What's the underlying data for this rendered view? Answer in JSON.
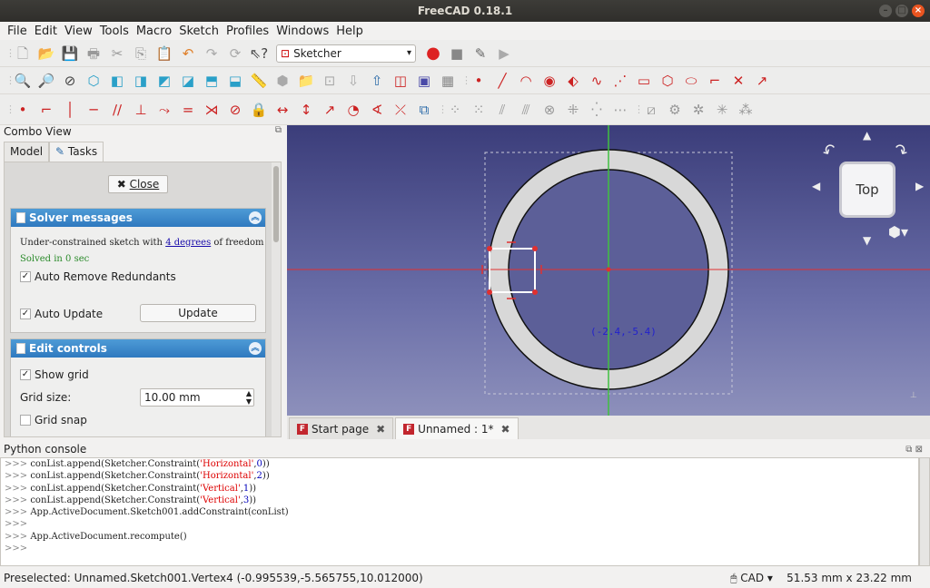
{
  "window": {
    "title": "FreeCAD 0.18.1"
  },
  "menu": [
    "File",
    "Edit",
    "View",
    "Tools",
    "Macro",
    "Sketch",
    "Profiles",
    "Windows",
    "Help"
  ],
  "workbench": "Sketcher",
  "combo": {
    "title": "Combo View",
    "tabs": [
      "Model",
      "Tasks"
    ]
  },
  "task": {
    "close_label": "Close",
    "solver": {
      "title": "Solver messages",
      "text_pre": "Under-constrained sketch with ",
      "link": "4 degrees",
      "text_post": " of freedom",
      "solved": "Solved in 0 sec",
      "auto_remove": "Auto Remove Redundants",
      "auto_update": "Auto Update",
      "update_btn": "Update"
    },
    "edit": {
      "title": "Edit controls",
      "show_grid": "Show grid",
      "grid_size_label": "Grid size:",
      "grid_size_value": "10.00 mm",
      "grid_snap": "Grid snap"
    }
  },
  "viewport": {
    "coord_label": "(-2.4,-5.4)",
    "navcube_face": "Top",
    "colors": {
      "x_axis": "#e03030",
      "y_axis": "#40c040",
      "ring": "#d8d8d8"
    }
  },
  "doctabs": [
    "Start page",
    "Unnamed : 1*"
  ],
  "console": {
    "title": "Python console",
    "lines": [
      {
        "p": ">>> ",
        "pre": "conList.append(Sketcher.Constraint(",
        "s": "'Horizontal'",
        "mid": ",",
        "n": "0",
        "post": "))"
      },
      {
        "p": ">>> ",
        "pre": "conList.append(Sketcher.Constraint(",
        "s": "'Horizontal'",
        "mid": ",",
        "n": "2",
        "post": "))"
      },
      {
        "p": ">>> ",
        "pre": "conList.append(Sketcher.Constraint(",
        "s": "'Vertical'",
        "mid": ",",
        "n": "1",
        "post": "))"
      },
      {
        "p": ">>> ",
        "pre": "conList.append(Sketcher.Constraint(",
        "s": "'Vertical'",
        "mid": ",",
        "n": "3",
        "post": "))"
      },
      {
        "p": ">>> ",
        "pre": "App.ActiveDocument.Sketch001.addConstraint(conList)",
        "s": "",
        "mid": "",
        "n": "",
        "post": ""
      },
      {
        "p": ">>> ",
        "pre": "",
        "s": "",
        "mid": "",
        "n": "",
        "post": ""
      },
      {
        "p": ">>> ",
        "pre": "App.ActiveDocument.recompute()",
        "s": "",
        "mid": "",
        "n": "",
        "post": ""
      },
      {
        "p": ">>> ",
        "pre": "",
        "s": "",
        "mid": "",
        "n": "",
        "post": ""
      }
    ]
  },
  "status": {
    "left": "Preselected: Unnamed.Sketch001.Vertex4 (-0.995539,-5.565755,10.012000)",
    "mode": "CAD",
    "dims": "51.53 mm x 23.22 mm"
  }
}
